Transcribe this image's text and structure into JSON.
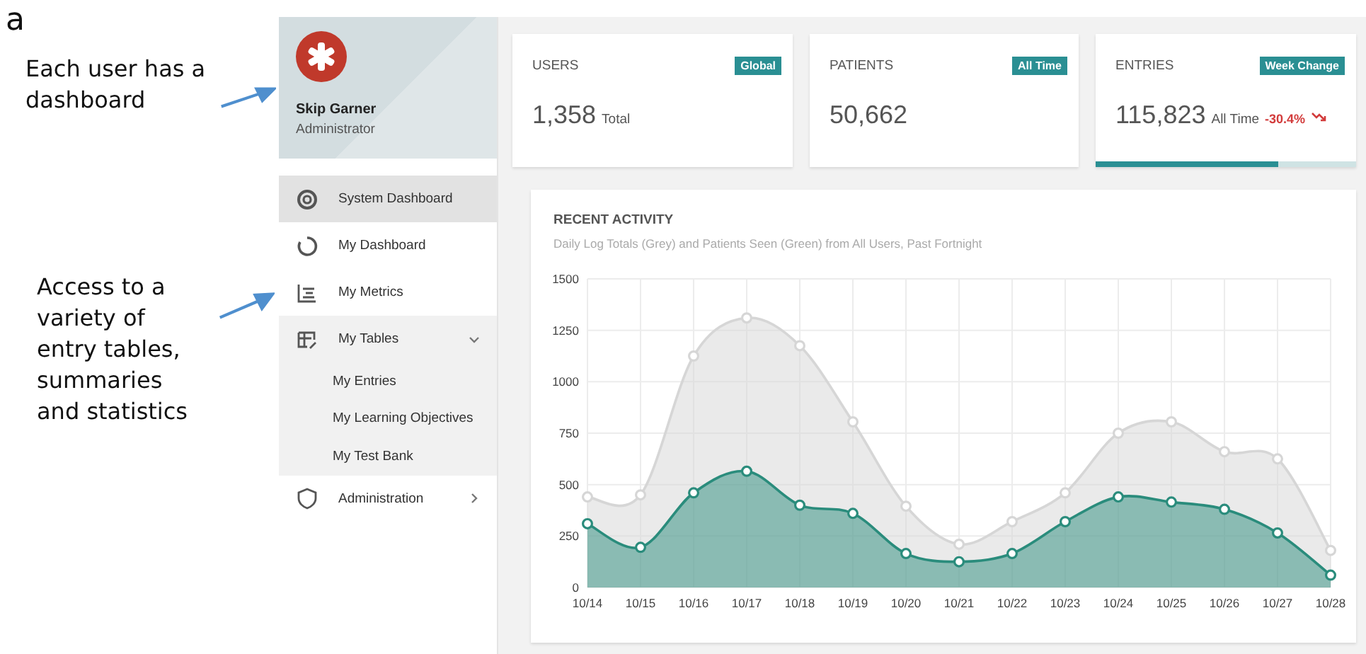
{
  "figure_label": "a",
  "annotations": [
    {
      "text": "Each user has a dashboard"
    },
    {
      "text": "Access to a variety of entry tables, summaries and statistics"
    }
  ],
  "profile": {
    "name": "Skip Garner",
    "role": "Administrator"
  },
  "sidebar": {
    "items": [
      {
        "label": "System Dashboard",
        "selected": true
      },
      {
        "label": "My Dashboard",
        "selected": false
      },
      {
        "label": "My Metrics",
        "selected": false
      },
      {
        "label": "My Tables",
        "selected": false,
        "expanded": true,
        "children": [
          {
            "label": "My Entries"
          },
          {
            "label": "My Learning Objectives"
          },
          {
            "label": "My Test Bank"
          }
        ]
      },
      {
        "label": "Administration",
        "selected": false,
        "expanded": false
      }
    ]
  },
  "stats": [
    {
      "label": "USERS",
      "badge": "Global",
      "value": "1,358",
      "unit": "Total"
    },
    {
      "label": "PATIENTS",
      "badge": "All Time",
      "value": "50,662"
    },
    {
      "label": "ENTRIES",
      "badge": "Week Change",
      "value": "115,823",
      "unit": "All Time",
      "change": "-30.4%",
      "level": 0.7
    }
  ],
  "activity": {
    "title": "RECENT ACTIVITY",
    "subtitle": "Daily Log Totals (Grey) and Patients Seen (Green) from All Users, Past Fortnight",
    "chart_data": {
      "type": "area",
      "categories": [
        "10/14",
        "10/15",
        "10/16",
        "10/17",
        "10/18",
        "10/19",
        "10/20",
        "10/21",
        "10/22",
        "10/23",
        "10/24",
        "10/25",
        "10/26",
        "10/27",
        "10/28"
      ],
      "ylim": [
        0,
        1500
      ],
      "grid": true,
      "yticks": [
        0,
        250,
        500,
        750,
        1000,
        1250,
        1500
      ],
      "series": [
        {
          "color": "#d6d6d6",
          "values": [
            440,
            450,
            1125,
            1310,
            1175,
            805,
            395,
            210,
            320,
            460,
            750,
            805,
            660,
            625,
            180
          ]
        },
        {
          "color": "#2a8c7c",
          "values": [
            310,
            195,
            460,
            565,
            400,
            360,
            165,
            125,
            165,
            320,
            440,
            415,
            380,
            265,
            60
          ]
        }
      ]
    }
  }
}
